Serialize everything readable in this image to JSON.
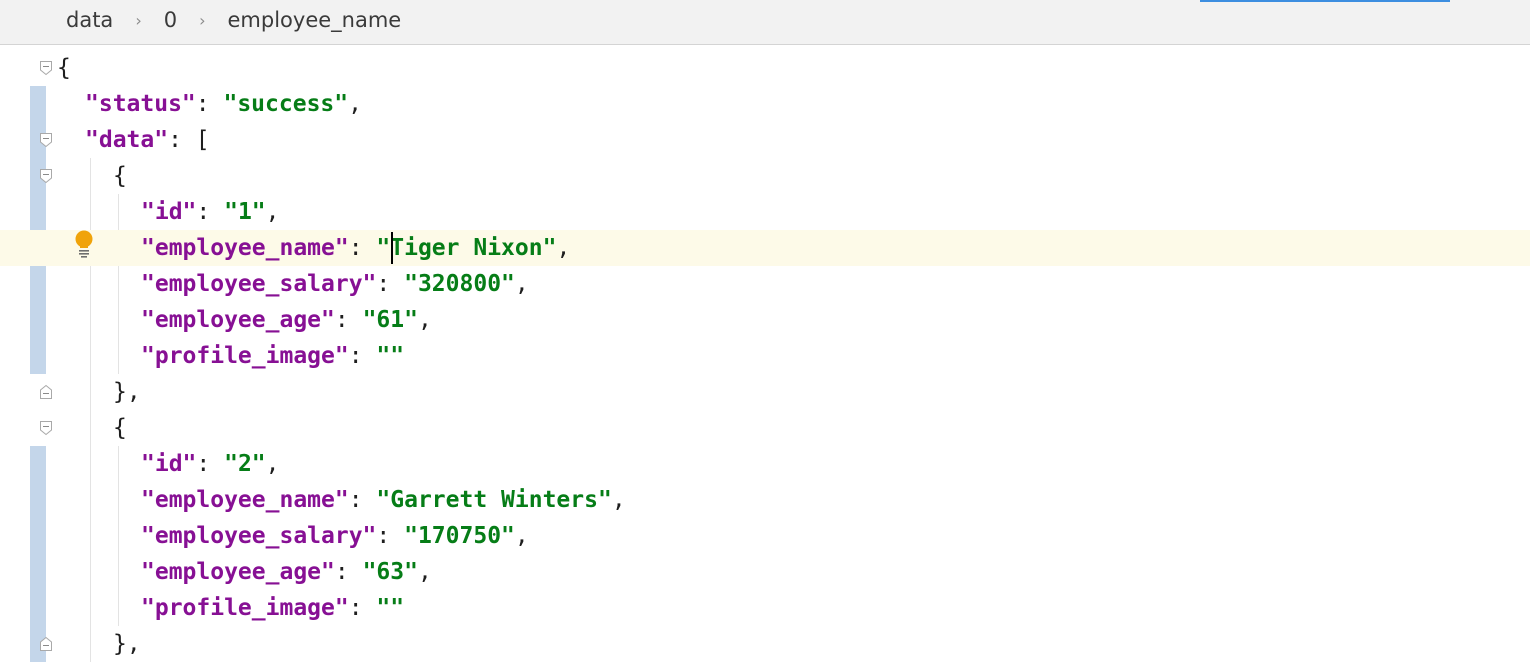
{
  "breadcrumb": {
    "items": [
      "data",
      "0",
      "employee_name"
    ],
    "separator": "›"
  },
  "editor": {
    "lines": [
      {
        "indent": 0,
        "tokens": [
          {
            "t": "punc",
            "v": "{"
          }
        ]
      },
      {
        "indent": 1,
        "tokens": [
          {
            "t": "key",
            "v": "\"status\""
          },
          {
            "t": "punc",
            "v": ": "
          },
          {
            "t": "str",
            "v": "\"success\""
          },
          {
            "t": "punc",
            "v": ","
          }
        ]
      },
      {
        "indent": 1,
        "tokens": [
          {
            "t": "key",
            "v": "\"data\""
          },
          {
            "t": "punc",
            "v": ": ["
          }
        ]
      },
      {
        "indent": 2,
        "tokens": [
          {
            "t": "punc",
            "v": "{"
          }
        ]
      },
      {
        "indent": 3,
        "tokens": [
          {
            "t": "key",
            "v": "\"id\""
          },
          {
            "t": "punc",
            "v": ": "
          },
          {
            "t": "str",
            "v": "\"1\""
          },
          {
            "t": "punc",
            "v": ","
          }
        ]
      },
      {
        "indent": 3,
        "tokens": [
          {
            "t": "key",
            "v": "\"employee_name\""
          },
          {
            "t": "punc",
            "v": ": "
          },
          {
            "t": "str",
            "v": "\"Tiger Nixon\""
          },
          {
            "t": "punc",
            "v": ","
          }
        ]
      },
      {
        "indent": 3,
        "tokens": [
          {
            "t": "key",
            "v": "\"employee_salary\""
          },
          {
            "t": "punc",
            "v": ": "
          },
          {
            "t": "str",
            "v": "\"320800\""
          },
          {
            "t": "punc",
            "v": ","
          }
        ]
      },
      {
        "indent": 3,
        "tokens": [
          {
            "t": "key",
            "v": "\"employee_age\""
          },
          {
            "t": "punc",
            "v": ": "
          },
          {
            "t": "str",
            "v": "\"61\""
          },
          {
            "t": "punc",
            "v": ","
          }
        ]
      },
      {
        "indent": 3,
        "tokens": [
          {
            "t": "key",
            "v": "\"profile_image\""
          },
          {
            "t": "punc",
            "v": ": "
          },
          {
            "t": "str",
            "v": "\"\""
          }
        ]
      },
      {
        "indent": 2,
        "tokens": [
          {
            "t": "punc",
            "v": "},"
          }
        ]
      },
      {
        "indent": 2,
        "tokens": [
          {
            "t": "punc",
            "v": "{"
          }
        ]
      },
      {
        "indent": 3,
        "tokens": [
          {
            "t": "key",
            "v": "\"id\""
          },
          {
            "t": "punc",
            "v": ": "
          },
          {
            "t": "str",
            "v": "\"2\""
          },
          {
            "t": "punc",
            "v": ","
          }
        ]
      },
      {
        "indent": 3,
        "tokens": [
          {
            "t": "key",
            "v": "\"employee_name\""
          },
          {
            "t": "punc",
            "v": ": "
          },
          {
            "t": "str",
            "v": "\"Garrett Winters\""
          },
          {
            "t": "punc",
            "v": ","
          }
        ]
      },
      {
        "indent": 3,
        "tokens": [
          {
            "t": "key",
            "v": "\"employee_salary\""
          },
          {
            "t": "punc",
            "v": ": "
          },
          {
            "t": "str",
            "v": "\"170750\""
          },
          {
            "t": "punc",
            "v": ","
          }
        ]
      },
      {
        "indent": 3,
        "tokens": [
          {
            "t": "key",
            "v": "\"employee_age\""
          },
          {
            "t": "punc",
            "v": ": "
          },
          {
            "t": "str",
            "v": "\"63\""
          },
          {
            "t": "punc",
            "v": ","
          }
        ]
      },
      {
        "indent": 3,
        "tokens": [
          {
            "t": "key",
            "v": "\"profile_image\""
          },
          {
            "t": "punc",
            "v": ": "
          },
          {
            "t": "str",
            "v": "\"\""
          }
        ]
      },
      {
        "indent": 2,
        "tokens": [
          {
            "t": "punc",
            "v": "},"
          }
        ]
      }
    ],
    "current_line": 5,
    "caret_column": 18,
    "fold_open_lines": [
      0,
      2,
      3,
      10
    ],
    "fold_close_lines": [
      9,
      16
    ],
    "changed_line_ranges": [
      [
        1,
        8
      ],
      [
        11,
        16
      ]
    ],
    "intention_icon": "lightbulb-icon",
    "colors": {
      "key": "#871094",
      "string": "#067d17",
      "current_line": "#fdfae8",
      "change_marker": "#c4d6ea",
      "accent": "#3d8ee0"
    }
  }
}
